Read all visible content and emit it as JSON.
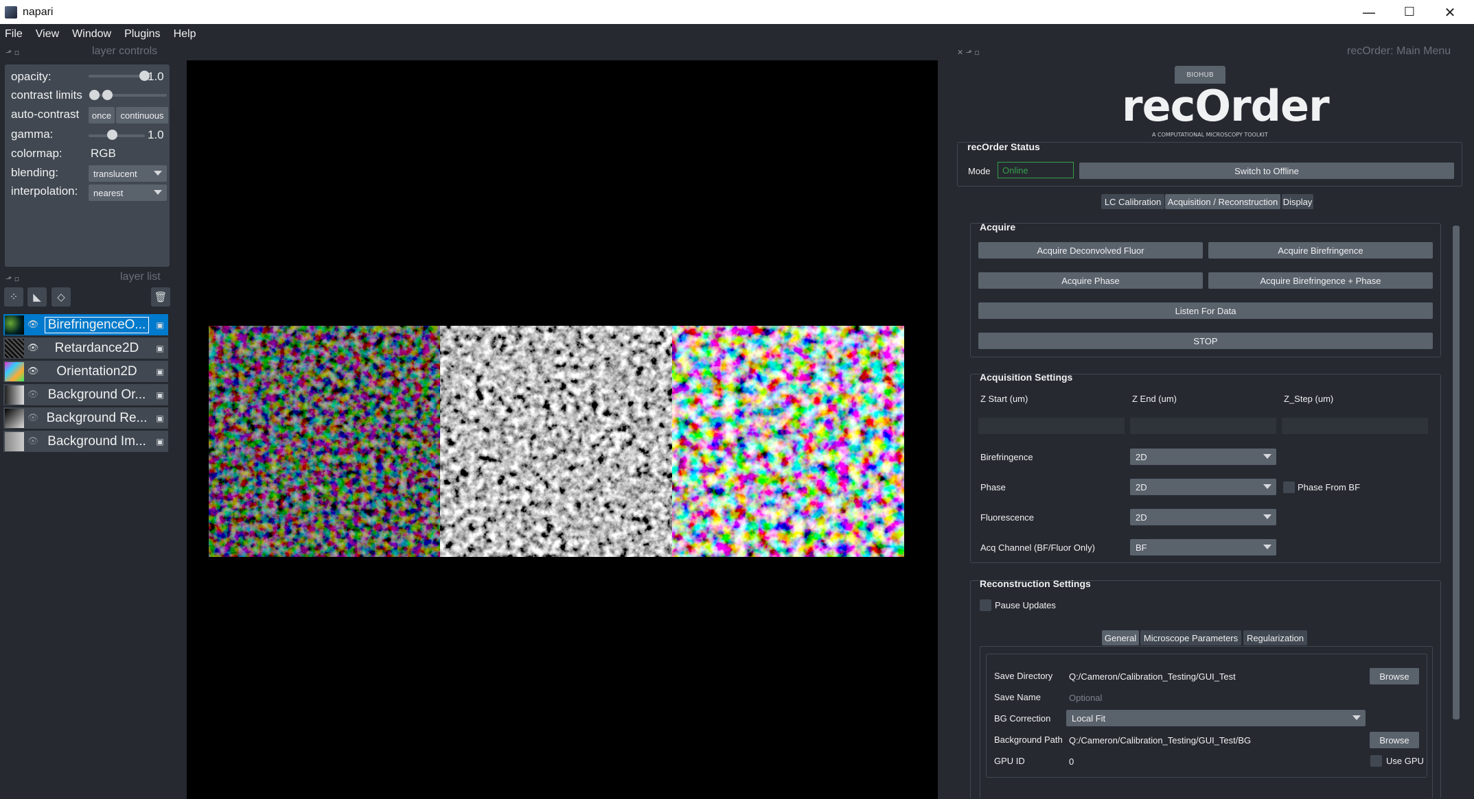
{
  "window": {
    "title": "napari",
    "min_glyph": "—",
    "max_glyph": "☐",
    "close_glyph": "✕"
  },
  "menu": [
    "File",
    "View",
    "Window",
    "Plugins",
    "Help"
  ],
  "layer_controls": {
    "dock_title": "layer controls",
    "opacity_label": "opacity:",
    "opacity_value": "1.0",
    "opacity_level": 1.0,
    "contrast_label": "contrast limits",
    "auto_contrast_label": "auto-contrast",
    "once_label": "once",
    "continuous_label": "continuous",
    "gamma_label": "gamma:",
    "gamma_value": "1.0",
    "colormap_label": "colormap:",
    "colormap_value": "RGB",
    "blending_label": "blending:",
    "blending_value": "translucent",
    "interpolation_label": "interpolation:",
    "interpolation_value": "nearest"
  },
  "layer_list": {
    "dock_title": "layer list",
    "layers": [
      {
        "name": "BirefringenceO...",
        "visible": true,
        "selected": true
      },
      {
        "name": "Retardance2D",
        "visible": true,
        "selected": false
      },
      {
        "name": "Orientation2D",
        "visible": true,
        "selected": false
      },
      {
        "name": "Background Or...",
        "visible": false,
        "selected": false
      },
      {
        "name": "Background Re...",
        "visible": false,
        "selected": false
      },
      {
        "name": "Background Im...",
        "visible": false,
        "selected": false
      }
    ]
  },
  "recorder": {
    "dock_title": "recOrder: Main Menu",
    "logo_text": "recOrder",
    "logo_sub": "A COMPUTATIONAL MICROSCOPY TOOLKIT",
    "logo_badge": "BIOHUB",
    "status_title": "recOrder Status",
    "mode_label": "Mode",
    "mode_value": "Online",
    "switch_button": "Switch to Offline",
    "tabs": [
      "LC Calibration",
      "Acquisition / Reconstruction",
      "Display"
    ],
    "acquire": {
      "title": "Acquire",
      "btn_deconv": "Acquire Deconvolved Fluor",
      "btn_biref": "Acquire Birefringence",
      "btn_phase": "Acquire Phase",
      "btn_biref_phase": "Acquire Birefringence + Phase",
      "btn_listen": "Listen For Data",
      "btn_stop": "STOP"
    },
    "acq_settings": {
      "title": "Acquisition Settings",
      "z_start": "Z Start (um)",
      "z_end": "Z End (um)",
      "z_step": "Z_Step (um)",
      "biref_label": "Birefringence",
      "biref_value": "2D",
      "phase_label": "Phase",
      "phase_value": "2D",
      "phase_from_bf": "Phase From BF",
      "fluor_label": "Fluorescence",
      "fluor_value": "2D",
      "acq_channel_label": "Acq Channel (BF/Fluor Only)",
      "acq_channel_value": "BF"
    },
    "recon_settings": {
      "title": "Reconstruction Settings",
      "pause_updates": "Pause Updates",
      "subtabs": [
        "General",
        "Microscope Parameters",
        "Regularization"
      ],
      "save_dir_label": "Save Directory",
      "save_dir_value": "Q:/Cameron/Calibration_Testing/GUI_Test",
      "save_name_label": "Save Name",
      "save_name_placeholder": "Optional",
      "bg_corr_label": "BG Correction",
      "bg_corr_value": "Local Fit",
      "bg_path_label": "Background Path",
      "bg_path_value": "Q:/Cameron/Calibration_Testing/GUI_Test/BG",
      "gpu_id_label": "GPU ID",
      "gpu_id_value": "0",
      "use_gpu": "Use GPU",
      "browse": "Browse"
    }
  },
  "colors": {
    "accent": "#007acc",
    "panel": "#414851",
    "background": "#262930",
    "online": "#35a14a"
  }
}
